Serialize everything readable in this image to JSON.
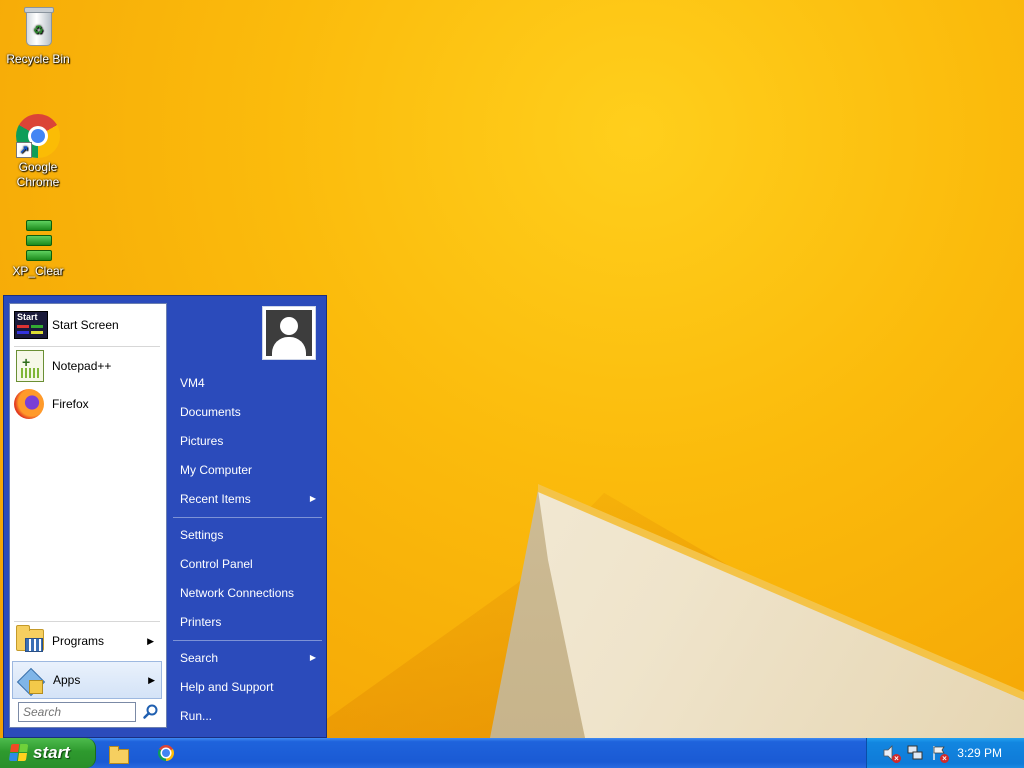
{
  "desktop": {
    "icons": [
      {
        "label": "Recycle Bin"
      },
      {
        "label": "Google Chrome"
      },
      {
        "label": "XP_Clear"
      }
    ]
  },
  "start_menu": {
    "pinned": [
      {
        "label": "Start Screen",
        "icon": "start-screen-icon"
      },
      {
        "label": "Notepad++",
        "icon": "notepad-plus-plus-icon"
      },
      {
        "label": "Firefox",
        "icon": "firefox-icon"
      }
    ],
    "bottom": [
      {
        "label": "Programs",
        "icon": "programs-folder-icon"
      },
      {
        "label": "Apps",
        "icon": "apps-icon"
      }
    ],
    "search": {
      "placeholder": "Search",
      "value": ""
    },
    "places": [
      {
        "label": "VM4"
      },
      {
        "label": "Documents"
      },
      {
        "label": "Pictures"
      },
      {
        "label": "My Computer"
      },
      {
        "label": "Recent Items"
      },
      {
        "label": "Settings"
      },
      {
        "label": "Control Panel"
      },
      {
        "label": "Network Connections"
      },
      {
        "label": "Printers"
      },
      {
        "label": "Search"
      },
      {
        "label": "Help and Support"
      },
      {
        "label": "Run..."
      }
    ]
  },
  "taskbar": {
    "start_label": "start",
    "clock": "3:29 PM"
  },
  "colors": {
    "wallpaper": "#fbbb0c",
    "start_menu_blue": "#2b4bbb",
    "start_button_green": "#2e9a2e",
    "taskbar_blue": "#1a5ad4",
    "tray_blue": "#0f7bd8"
  }
}
